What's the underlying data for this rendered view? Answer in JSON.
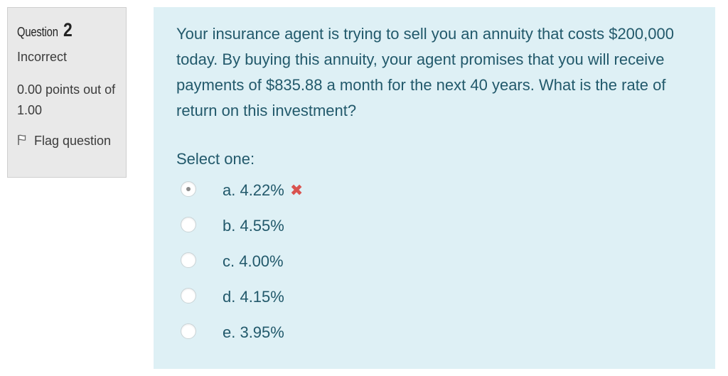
{
  "info": {
    "question_word": "Question",
    "question_number": "2",
    "state": "Incorrect",
    "grade": "0.00 points out of 1.00",
    "flag_label": "Flag question"
  },
  "question": {
    "text": "Your insurance agent is trying to sell you an annuity that costs $200,000 today. By buying this annuity, your agent promises that you will receive payments of $835.88 a month for the next 40 years. What is the rate of return on this investment?",
    "prompt": "Select one:",
    "answers": [
      {
        "label": "a. 4.22%",
        "selected": true,
        "feedback_icon": "incorrect-x-icon",
        "feedback_glyph": "✖"
      },
      {
        "label": "b. 4.55%",
        "selected": false
      },
      {
        "label": "c. 4.00%",
        "selected": false
      },
      {
        "label": "d. 4.15%",
        "selected": false
      },
      {
        "label": "e. 3.95%",
        "selected": false
      }
    ]
  },
  "colors": {
    "info_background": "#e9e9e9",
    "content_background": "#def0f5",
    "text_teal": "#22596b",
    "incorrect_red": "#d9534f"
  }
}
